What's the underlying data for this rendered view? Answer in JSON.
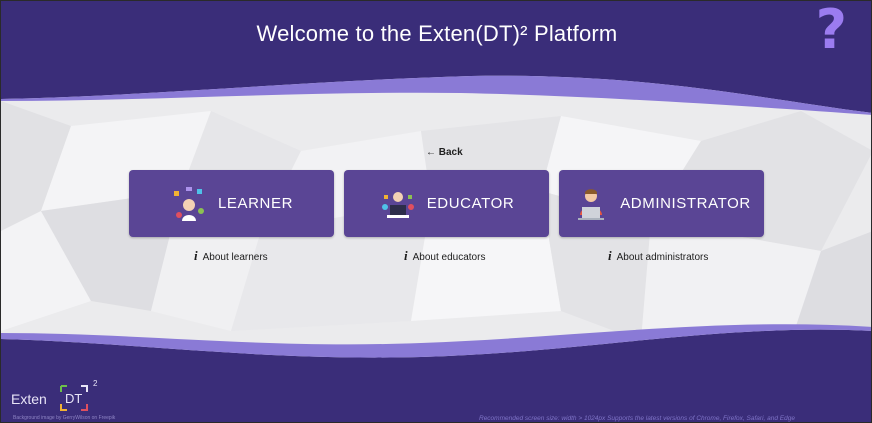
{
  "header": {
    "title": "Welcome to the Exten(DT)² Platform",
    "help_icon": "?"
  },
  "nav": {
    "back_label": "← Back"
  },
  "roles": [
    {
      "label": "LEARNER",
      "icon": "learner-icon",
      "about": "About learners"
    },
    {
      "label": "EDUCATOR",
      "icon": "educator-icon",
      "about": "About educators"
    },
    {
      "label": "ADMINISTRATOR",
      "icon": "administrator-icon",
      "about": "About administrators"
    }
  ],
  "about_marker": "i",
  "footer": {
    "logo_word": "Exten",
    "logo_dt": "DT",
    "logo_sup": "2",
    "credit": "Background image by GerryWilson on Freepik",
    "recommendation": "Recommended screen size: width > 1024px Supports the latest versions of Chrome, Firefox, Safari, and Edge"
  },
  "colors": {
    "banner": "#3a2d79",
    "accent": "#9b7cf0",
    "card": "#5a4595",
    "wave": "#8a7ad6"
  }
}
